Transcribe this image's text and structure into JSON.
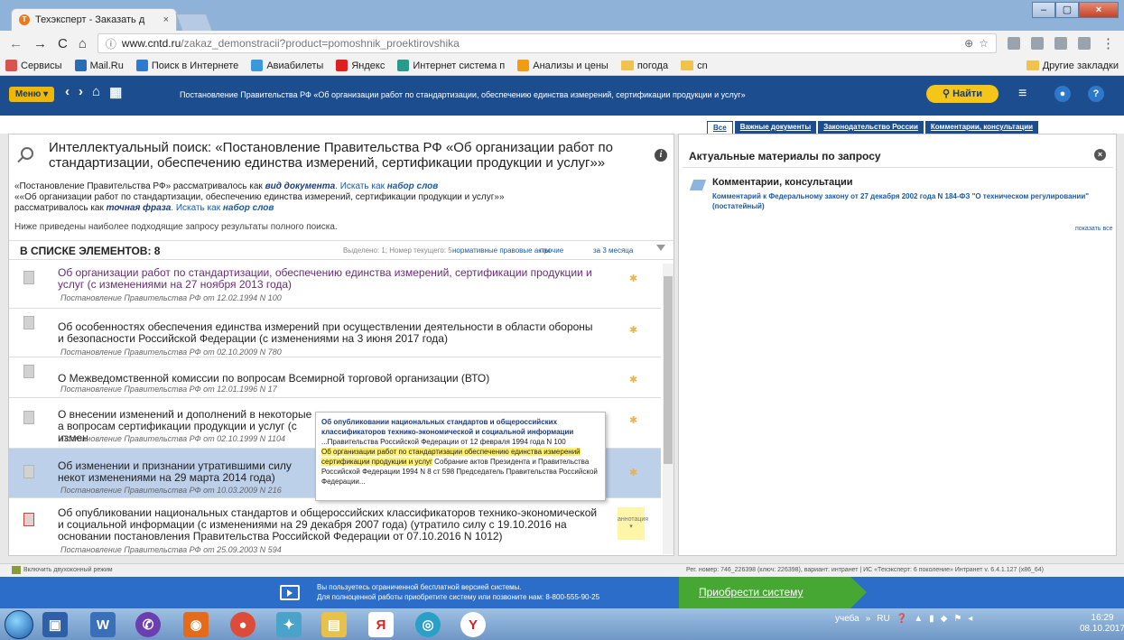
{
  "browser": {
    "tab_title": "Техэксперт - Заказать д",
    "tab_close": "×",
    "url_host": "www.cntd.ru",
    "url_path": "/zakaz_demonstracii?product=pomoshnik_proektirovshika",
    "window_buttons": [
      "–",
      "▢",
      "×"
    ]
  },
  "bookmarks": [
    {
      "label": "Сервисы",
      "color": "#d9534f"
    },
    {
      "label": "Mail.Ru",
      "color": "#2a6db5"
    },
    {
      "label": "Поиск в Интернете",
      "color": "#2a7bd1"
    },
    {
      "label": "Авиабилеты",
      "color": "#3a9ad9"
    },
    {
      "label": "Яндекс",
      "color": "#e02020"
    },
    {
      "label": "Интернет система п",
      "color": "#2a9a8a"
    },
    {
      "label": "Анализы и цены",
      "color": "#f39c12"
    },
    {
      "label": "погода",
      "color": "#f2c24e"
    },
    {
      "label": "cn",
      "color": "#f2c24e"
    }
  ],
  "other_bookmarks": "Другие закладки",
  "app": {
    "menu_label": "Меню ▾",
    "doc_title": "Постановление Правительства РФ «Об организации работ по стандартизации, обеспечению единства измерений, сертификации продукции и услуг»",
    "find_label": "Найти"
  },
  "filter_tabs": [
    "Все",
    "Важные документы",
    "Законодательство России",
    "Комментарии, консультации"
  ],
  "search": {
    "title": "Интеллектуальный поиск: «Постановление Правительства РФ «Об организации работ по стандартизации, обеспечению единства измерений, сертификации продукции и услуг»»",
    "note1_a": "«Постановление Правительства РФ» рассматривалось как ",
    "note1_b": "вид документа",
    "note1_c": ". Искать как ",
    "note1_d": "набор слов",
    "note2": "««Об организации работ по стандартизации, обеспечению единства измерений, сертификации продукции и услуг»»",
    "note3_a": "рассматривалось как ",
    "note3_b": "точная фраза",
    "note3_c": ". Искать как ",
    "note3_d": "набор слов",
    "note4": "Ниже приведены наиболее подходящие запросу результаты полного поиска."
  },
  "list": {
    "header": "В СПИСКЕ ЭЛЕМЕНТОВ: 8",
    "selected": "Выделено: 1; Номер текущего: 5",
    "filter1": "нормативные правовые акты",
    "filter2": "прочие",
    "filter3": "за 3 месяца",
    "items": [
      {
        "title": "Об организации работ по стандартизации, обеспечению единства измерений, сертификации продукции и услуг (с изменениями на 27 ноября 2013 года)",
        "sub": "Постановление Правительства РФ от 12.02.1994 N 100"
      },
      {
        "title": "Об особенностях обеспечения единства измерений при осуществлении деятельности в области обороны и безопасности Российской Федерации (с изменениями на 3 июня 2017 года)",
        "sub": "Постановление Правительства РФ от 02.10.2009 N 780"
      },
      {
        "title": "О Межведомственной комиссии по вопросам Всемирной торговой организации (ВТО)",
        "sub": "Постановление Правительства РФ от 12.01.1996 N 17"
      },
      {
        "title": "О внесении изменений и дополнений в некоторые а вопросам сертификации продукции и услуг (с измен",
        "sub": "Постановление Правительства РФ от 02.10.1999 N 1104"
      },
      {
        "title": "Об изменении и признании утратившими силу некот изменениями на 29 марта 2014 года)",
        "sub": "Постановление Правительства РФ от 10.03.2009 N 216"
      },
      {
        "title": "Об опубликовании национальных стандартов и общероссийских классификаторов технико-экономической и социальной информации (с изменениями на 29 декабря 2007 года) (утратило силу с 19.10.2016 на основании постановления Правительства Российской Федерации от 07.10.2016 N 1012)",
        "sub": "Постановление Правительства РФ от 25.09.2003 N 594",
        "annotation": "аннотация"
      }
    ]
  },
  "popup": {
    "title": "Об опубликовании национальных стандартов и общероссийских классификаторов технико-экономической и социальной информации",
    "line1": "...Правительства Российской Федерации от 12 февраля 1994 года N 100",
    "highlight": "Об организации работ по стандартизации обеспечению единства измерений сертификации продукции и услуг",
    "line2": " Собрание актов Президента и Правительства Российской Федерации 1994 N 8 ст 598 Председатель Правительства Российской Федерации..."
  },
  "right": {
    "title": "Актуальные материалы по запросу",
    "section": "Комментарии, консультации",
    "link": "Комментарий к Федеральному закону от 27 декабря 2002 года N 184-ФЗ \"О техническом регулировании\" (постатейный)",
    "more": "показать все"
  },
  "status": {
    "left": "Включить двухоконный режим",
    "right": "Рег. номер: 746_226398 (ключ: 226398), вариант: интранет  |  ИС «Техэксперт: 6 поколение» Интранет v. 6.4.1.127 (x86_64)"
  },
  "promo": {
    "line1": "Вы пользуетесь ограниченной бесплатной версией системы.",
    "line2": "Для полноценной работы приобретите систему или позвоните нам: 8-800-555-90-25",
    "buy": "Приобрести систему"
  },
  "taskbar": {
    "lang_label": "учеба",
    "lang": "RU",
    "time": "16:29",
    "date": "08.10.2017"
  }
}
